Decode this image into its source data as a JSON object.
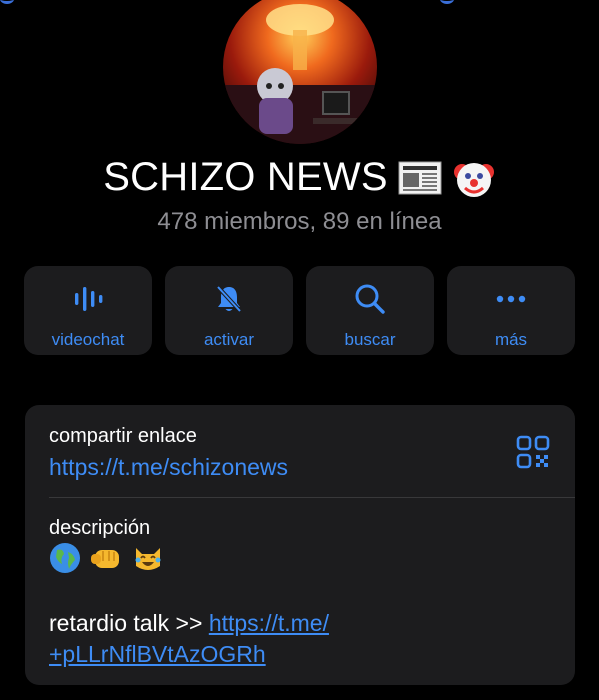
{
  "channel": {
    "title": "SCHIZO NEWS",
    "title_emojis": [
      "newspaper-emoji",
      "clown-face-emoji"
    ],
    "subtitle": "478 miembros, 89 en línea"
  },
  "actions": [
    {
      "label": "videochat",
      "icon": "voice-waveform-icon"
    },
    {
      "label": "activar",
      "icon": "bell-slash-icon"
    },
    {
      "label": "buscar",
      "icon": "search-icon"
    },
    {
      "label": "más",
      "icon": "more-dots-icon"
    }
  ],
  "info": {
    "share_label": "compartir enlace",
    "share_link": "https://t.me/schizonews",
    "description_label": "descripción",
    "description_emojis": [
      "globe-emoji",
      "fist-emoji",
      "laughing-cat-emoji"
    ],
    "description_text": "retardio talk >> ",
    "description_link_line1": "https://t.me/",
    "description_link_line2": "+pLLrNflBVtAzOGRh"
  },
  "colors": {
    "background": "#000000",
    "card": "#1c1c1e",
    "accent": "#3e8cf5",
    "secondary_text": "#8e8e93"
  }
}
